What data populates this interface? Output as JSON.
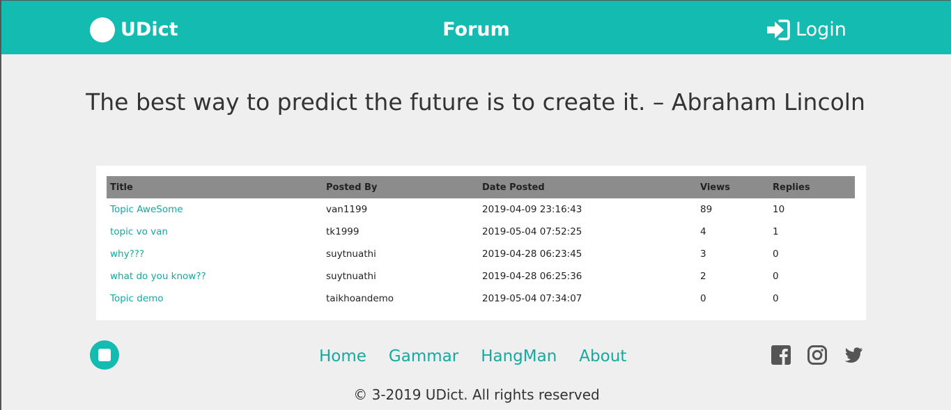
{
  "header": {
    "brand_name": "UDict",
    "center_title": "Forum",
    "login_label": "Login"
  },
  "quote": "The best way to predict the future is to create it. – Abraham Lincoln",
  "table": {
    "columns": [
      "Title",
      "Posted By",
      "Date Posted",
      "Views",
      "Replies"
    ],
    "rows": [
      {
        "title": "Topic AweSome",
        "posted_by": "van1199",
        "date": "2019-04-09 23:16:43",
        "views": "89",
        "replies": "10"
      },
      {
        "title": "topic vo van",
        "posted_by": "tk1999",
        "date": "2019-05-04 07:52:25",
        "views": "4",
        "replies": "1"
      },
      {
        "title": "why???",
        "posted_by": "suytnuathi",
        "date": "2019-04-28 06:23:45",
        "views": "3",
        "replies": "0"
      },
      {
        "title": "what do you know??",
        "posted_by": "suytnuathi",
        "date": "2019-04-28 06:25:36",
        "views": "2",
        "replies": "0"
      },
      {
        "title": "Topic demo",
        "posted_by": "taikhoandemo",
        "date": "2019-05-04 07:34:07",
        "views": "0",
        "replies": "0"
      }
    ]
  },
  "footer": {
    "nav": [
      "Home",
      "Gammar",
      "HangMan",
      "About"
    ],
    "social_icons": [
      "facebook-icon",
      "instagram-icon",
      "twitter-icon"
    ],
    "copyright": "© 3-2019 UDict. All rights reserved"
  },
  "colors": {
    "accent": "#14bbb1",
    "link": "#14a89e",
    "table_header": "#8c8c8c",
    "social": "#555555"
  }
}
